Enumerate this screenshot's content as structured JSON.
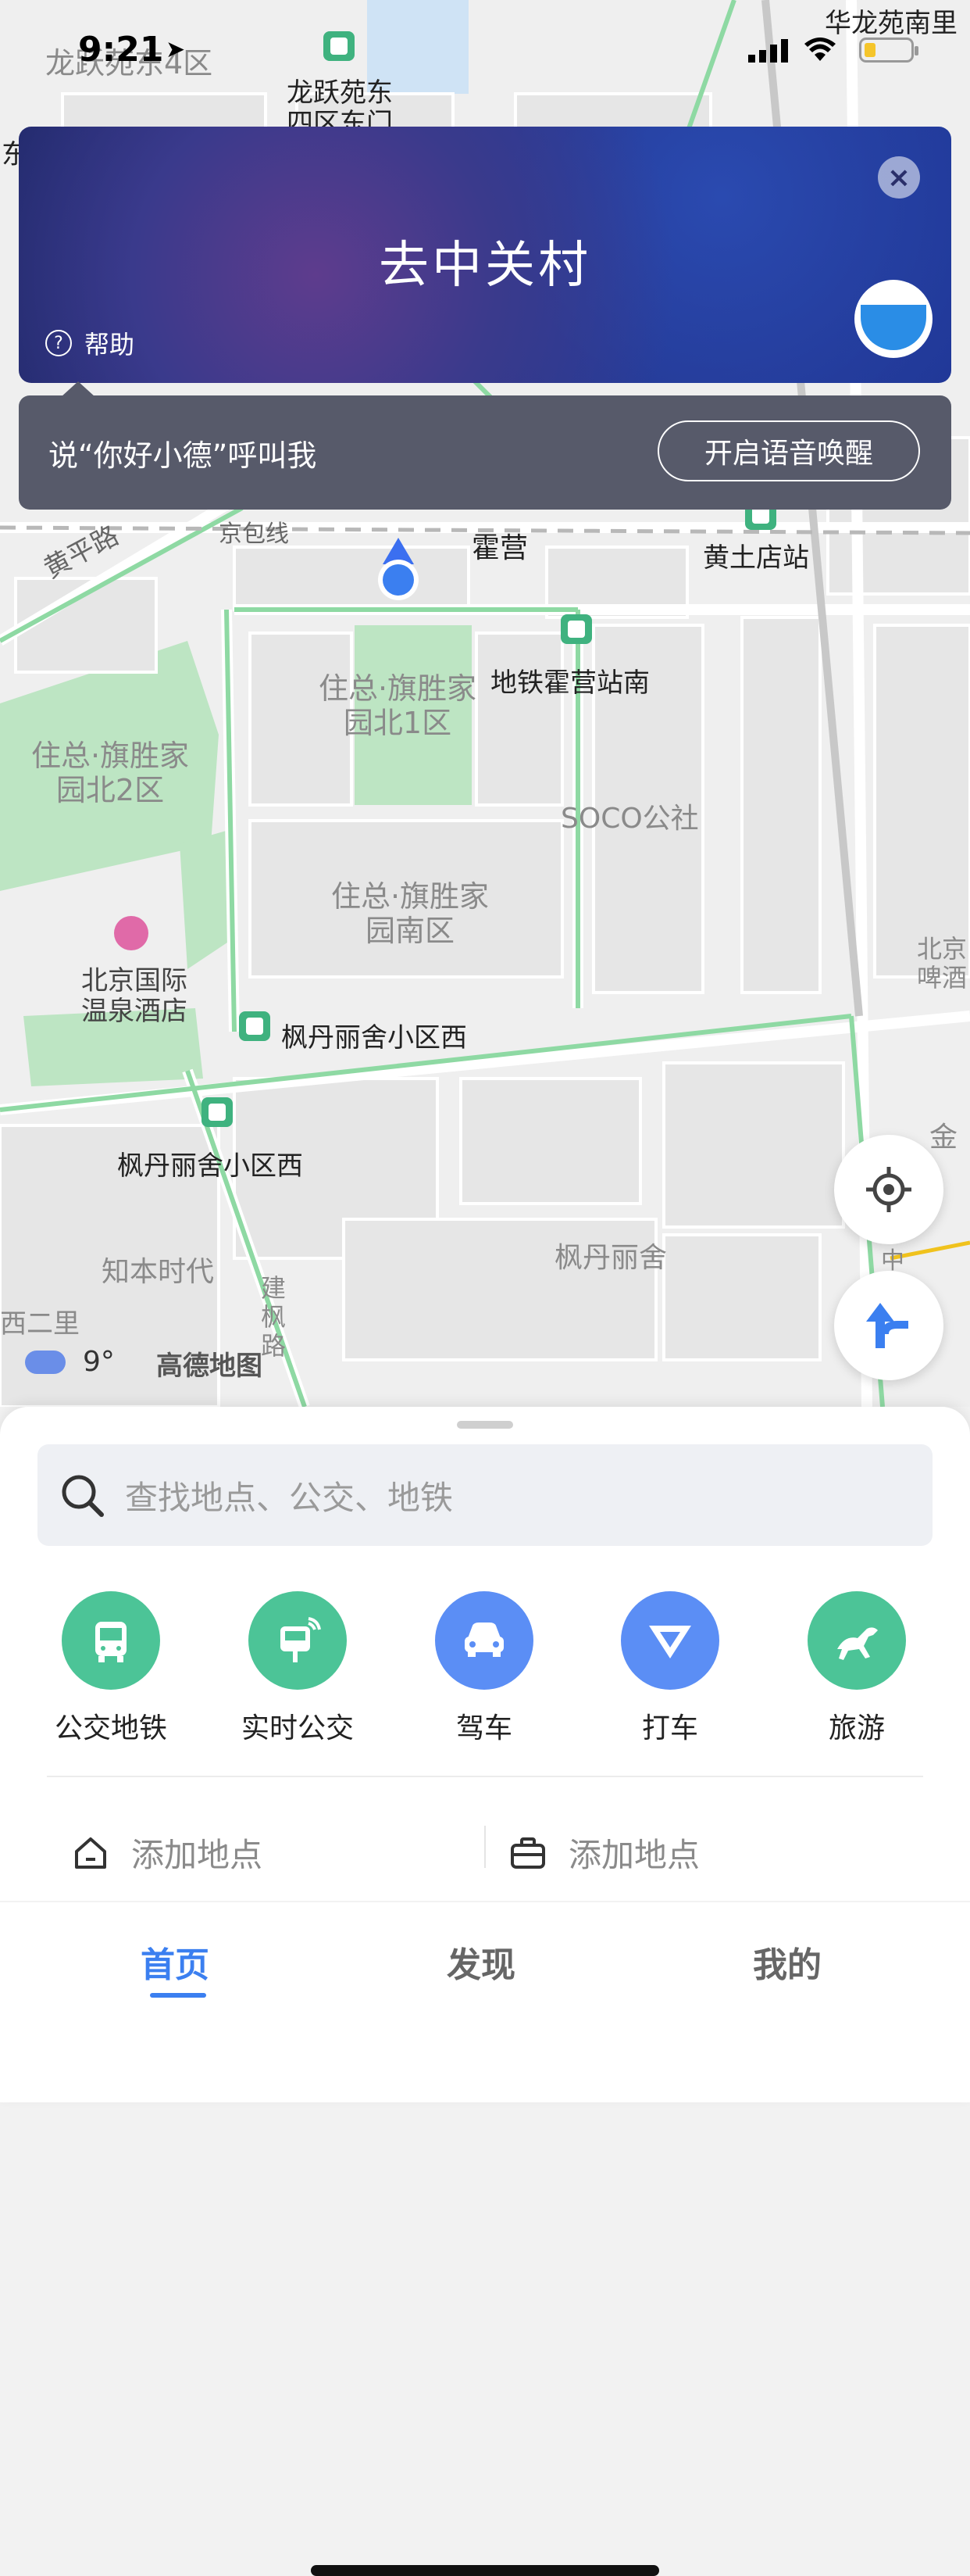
{
  "status_bar": {
    "time": "9:21",
    "location_arrow": "location-arrow-icon",
    "signal": "signal-icon",
    "wifi": "wifi-icon",
    "battery": "battery-low-icon",
    "battery_color": "#f5c52b"
  },
  "voice_card": {
    "title": "去中关村",
    "help_label": "帮助",
    "close": "close-icon",
    "mascot": "voice-assistant-mascot-icon"
  },
  "wake_tip": {
    "text": "说“你好小德”呼叫我",
    "button": "开启语音唤醒"
  },
  "map": {
    "labels": [
      "龙跃苑东4区",
      "龙跃苑东四区东门",
      "华龙苑南里",
      "东门",
      "京包线",
      "霍营",
      "黄土店站",
      "黄平路",
      "地铁霍营站南",
      "住总·旗胜家园北1区",
      "住总·旗胜家园北2区",
      "SOCO公社",
      "住总·旗胜家园南区",
      "北京国际温泉酒店",
      "枫丹丽舍小区西",
      "枫丹丽舍小区西",
      "知本时代",
      "枫丹丽舍",
      "建枫路",
      "西二里",
      "北京啤酒",
      "金",
      "中",
      "霍营"
    ],
    "weather": {
      "icon": "cloud-icon",
      "temperature": "9°"
    },
    "brand": "高德地图",
    "locate_button": "locate-icon",
    "route_button": "route-arrow-icon"
  },
  "search": {
    "placeholder": "查找地点、公交、地铁",
    "icon": "search-icon"
  },
  "quick_actions": [
    {
      "label": "公交地铁",
      "icon": "bus-icon",
      "color": "#4cc497"
    },
    {
      "label": "实时公交",
      "icon": "realtime-bus-icon",
      "color": "#4cc497"
    },
    {
      "label": "驾车",
      "icon": "car-icon",
      "color": "#5b8ef5"
    },
    {
      "label": "打车",
      "icon": "taxi-icon",
      "color": "#5b8ef5"
    },
    {
      "label": "旅游",
      "icon": "horse-icon",
      "color": "#4cc497"
    }
  ],
  "places": [
    {
      "icon": "home-icon",
      "label": "添加地点"
    },
    {
      "icon": "briefcase-icon",
      "label": "添加地点"
    }
  ],
  "tabs": [
    {
      "label": "首页",
      "active": true
    },
    {
      "label": "发现",
      "active": false
    },
    {
      "label": "我的",
      "active": false
    }
  ],
  "accent_color": "#3b7ff0"
}
